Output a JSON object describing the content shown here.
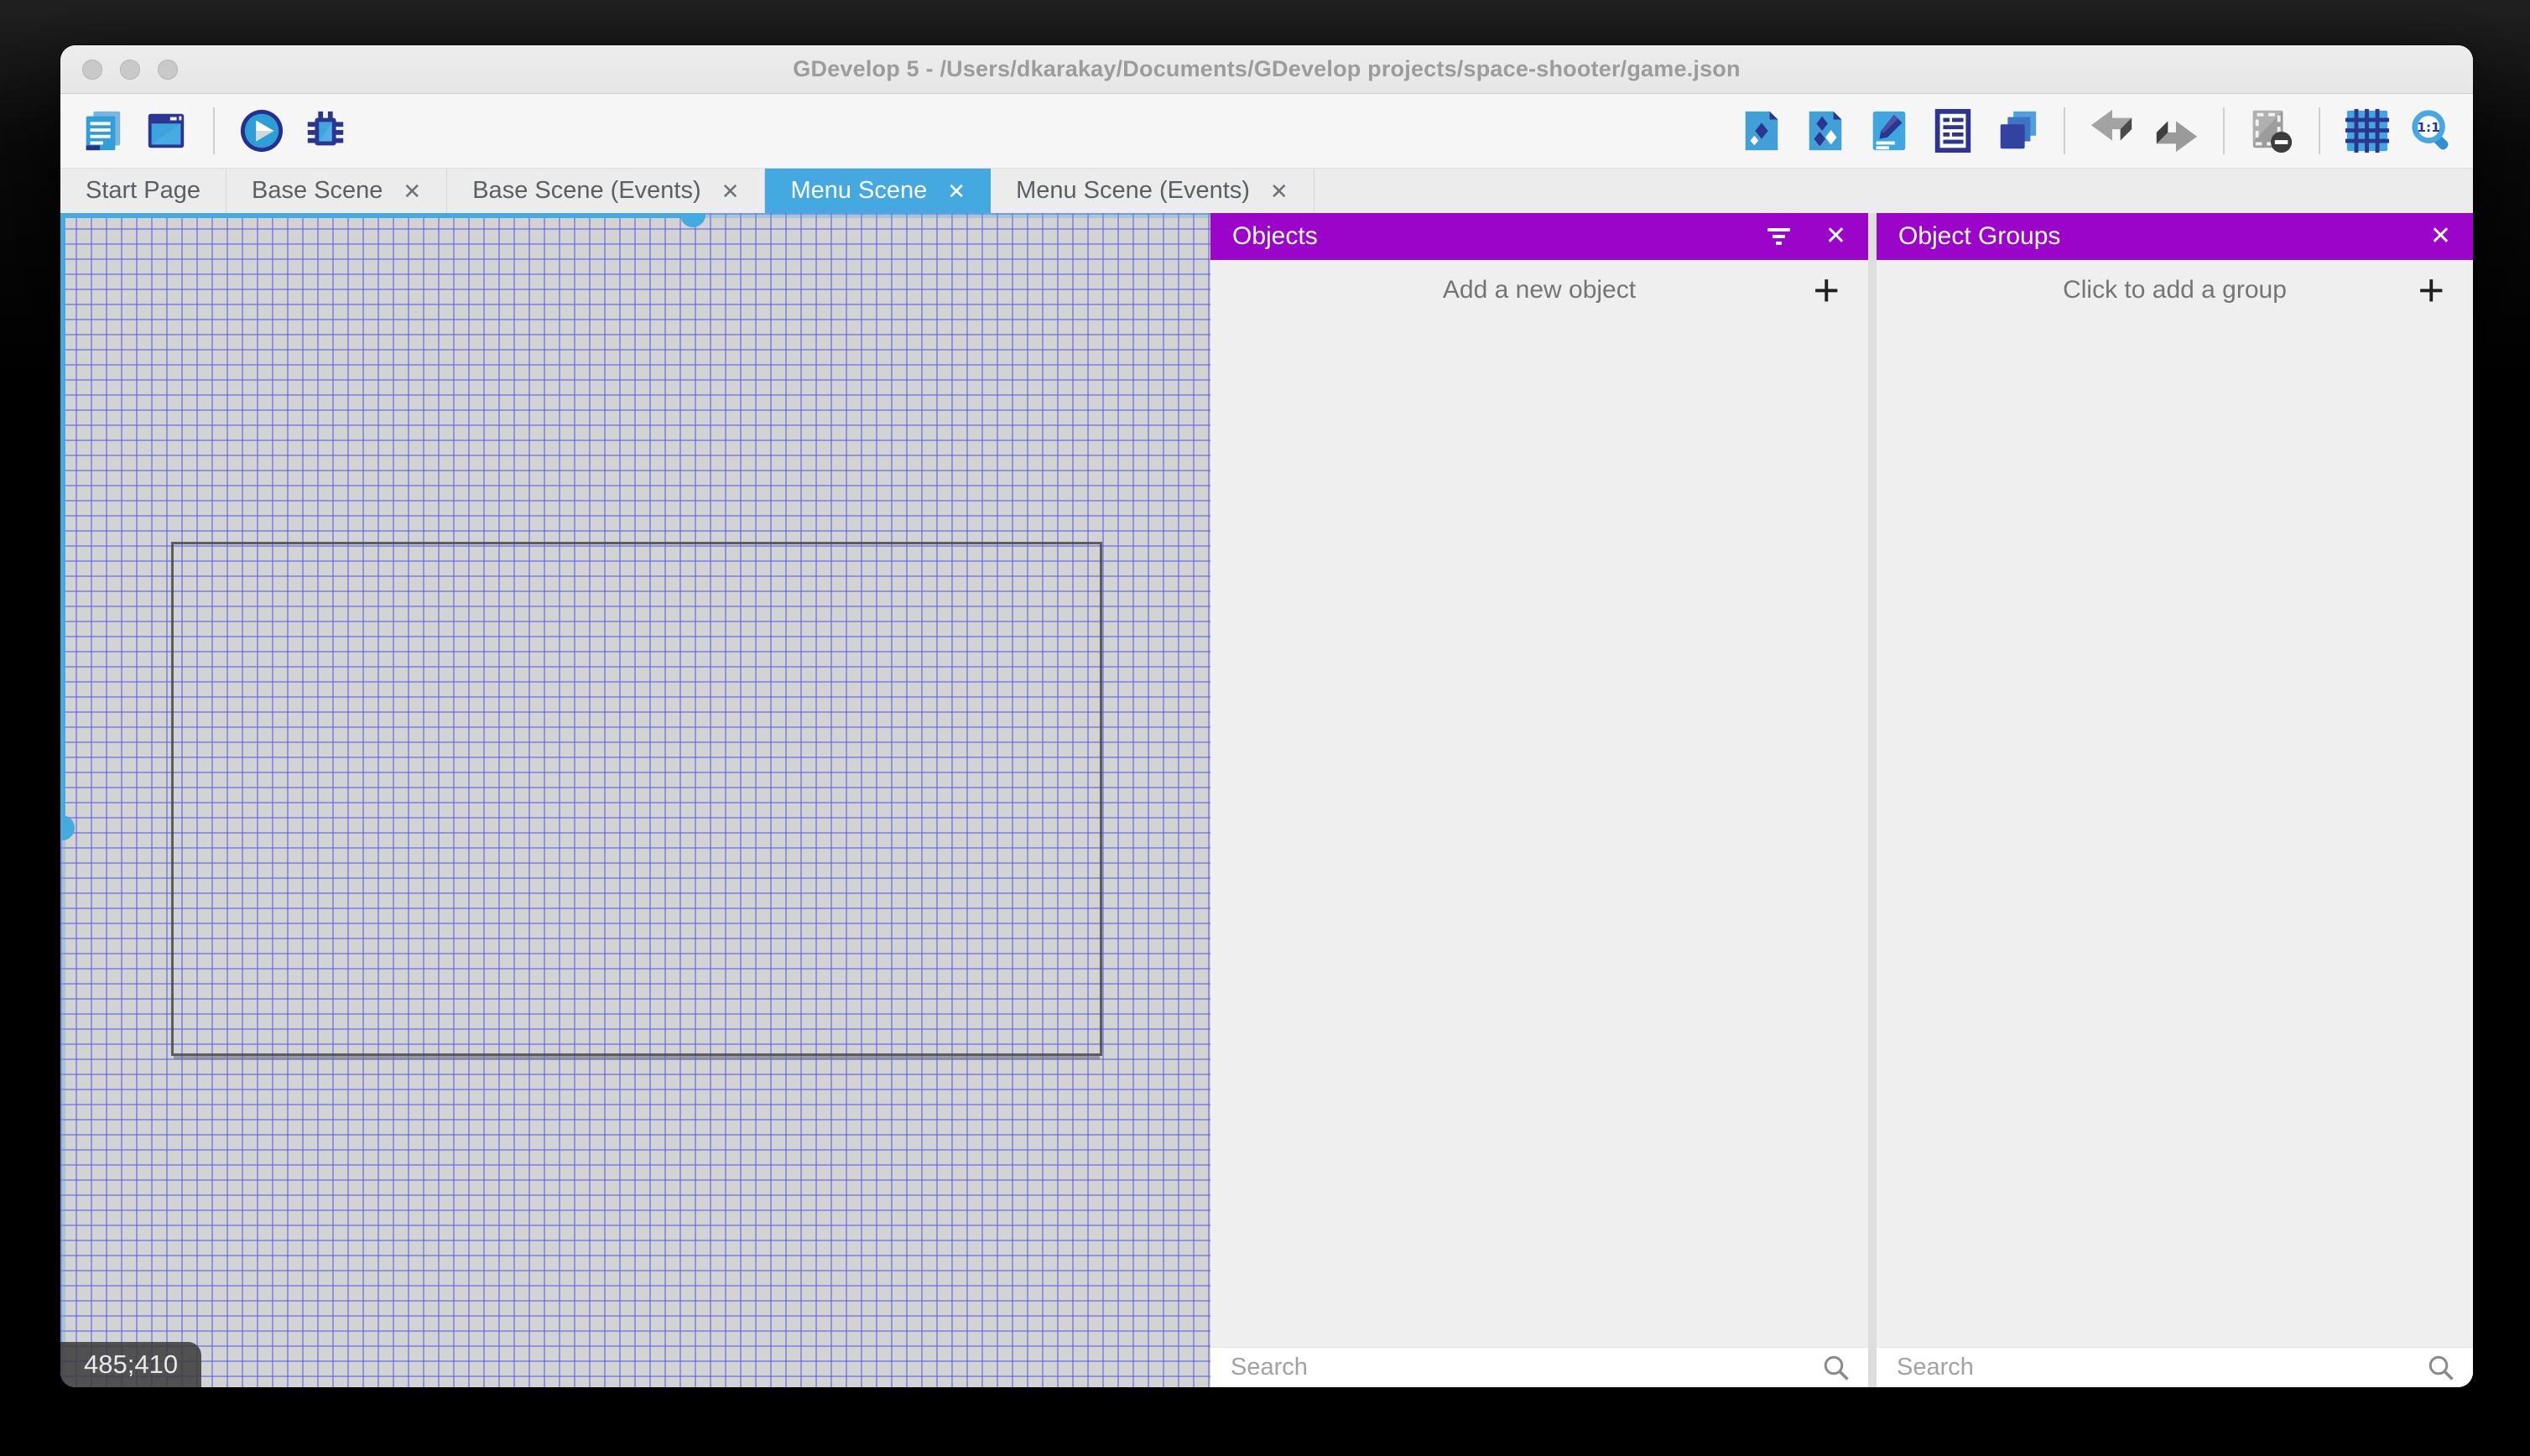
{
  "window_title": "GDevelop 5 - /Users/dkarakay/Documents/GDevelop projects/space-shooter/game.json",
  "toolbar": {
    "left_icons": [
      "project-manager-icon",
      "start-page-icon",
      "play-icon",
      "debug-icon"
    ],
    "right_icons": [
      "objects-editor-icon",
      "object-groups-editor-icon",
      "properties-icon",
      "instances-list-icon",
      "layers-icon",
      "undo-icon",
      "redo-icon",
      "window-mask-icon",
      "grid-icon",
      "zoom-reset-icon"
    ]
  },
  "tabs": [
    {
      "label": "Start Page",
      "active": false,
      "closable": false
    },
    {
      "label": "Base Scene",
      "active": false,
      "closable": true
    },
    {
      "label": "Base Scene (Events)",
      "active": false,
      "closable": true
    },
    {
      "label": "Menu Scene",
      "active": true,
      "closable": true
    },
    {
      "label": "Menu Scene (Events)",
      "active": false,
      "closable": true
    }
  ],
  "tab_close_glyph": "✕",
  "canvas": {
    "cursor_coordinates": "485;410"
  },
  "objects_panel": {
    "title": "Objects",
    "add_label": "Add a new object",
    "add_glyph": "+",
    "close_glyph": "✕",
    "search_placeholder": "Search"
  },
  "object_groups_panel": {
    "title": "Object Groups",
    "add_label": "Click to add a group",
    "add_glyph": "+",
    "close_glyph": "✕",
    "search_placeholder": "Search"
  },
  "colors": {
    "panel_header_purple": "#9a05c9",
    "active_tab_blue": "#44a8e1",
    "scrollbar_blue": "#45aade",
    "grid_line": "#5f5fe2",
    "canvas_bg": "#d3d3d3"
  }
}
